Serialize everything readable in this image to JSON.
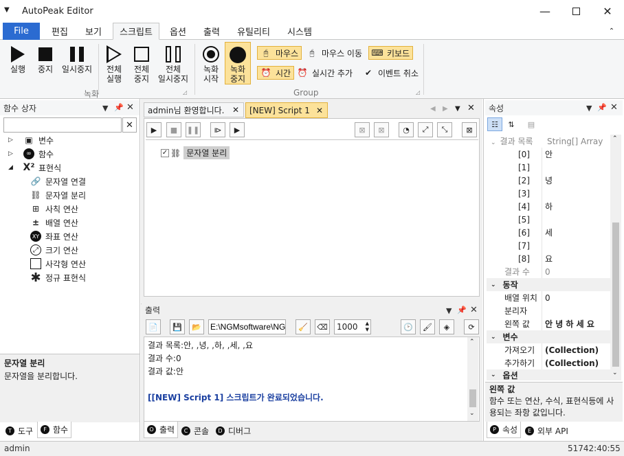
{
  "window": {
    "title": "AutoPeak Editor"
  },
  "menu": {
    "tabs": [
      "File",
      "편집",
      "보기",
      "스크립트",
      "옵션",
      "출력",
      "유틸리티",
      "시스템"
    ],
    "active": "스크립트"
  },
  "ribbon": {
    "record_group": {
      "label": "녹화",
      "buttons": [
        {
          "line1": "실행",
          "line2": ""
        },
        {
          "line1": "중지",
          "line2": ""
        },
        {
          "line1": "일시중지",
          "line2": ""
        },
        {
          "line1": "전체",
          "line2": "실행"
        },
        {
          "line1": "전체",
          "line2": "중지"
        },
        {
          "line1": "전체",
          "line2": "일시중지"
        }
      ]
    },
    "group": {
      "label": "Group",
      "rec_start": {
        "line1": "녹화",
        "line2": "시작"
      },
      "rec_stop": {
        "line1": "녹화",
        "line2": "중지"
      },
      "mouse": "마우스",
      "mouse_move": "마우스 이동",
      "keyboard": "키보드",
      "time": "시간",
      "realtime_add": "실시간 추가",
      "event_cancel": "이벤트 취소"
    }
  },
  "left_panel": {
    "title": "함수 상자",
    "search_placeholder": "",
    "tree": [
      {
        "label": "변수",
        "icon": "variable-icon",
        "expander": "▷",
        "level": 0
      },
      {
        "label": "함수",
        "icon": "function-icon",
        "expander": "▷",
        "level": 0
      },
      {
        "label": "표현식",
        "icon": "expression-icon",
        "expander": "◢",
        "level": 0
      },
      {
        "label": "문자열 연결",
        "icon": "link-icon",
        "level": 1
      },
      {
        "label": "문자열 분리",
        "icon": "unlink-icon",
        "level": 1
      },
      {
        "label": "사칙 연산",
        "icon": "calculator-icon",
        "level": 1
      },
      {
        "label": "배열 연산",
        "icon": "plus-minus-icon",
        "level": 1
      },
      {
        "label": "좌표 연산",
        "icon": "xy-icon",
        "level": 1
      },
      {
        "label": "크기 연산",
        "icon": "resize-icon",
        "level": 1
      },
      {
        "label": "사각형 연산",
        "icon": "rectangle-icon",
        "level": 1
      },
      {
        "label": "정규 표현식",
        "icon": "asterisk-icon",
        "level": 1
      }
    ],
    "desc_title": "문자열 분리",
    "desc_text": "문자열을 분리합니다.",
    "bottom_tabs": [
      {
        "badge": "T",
        "label": "도구"
      },
      {
        "badge": "F",
        "label": "함수"
      }
    ]
  },
  "editor": {
    "tabs": [
      {
        "label": "admin님 환영합니다."
      },
      {
        "label": "[NEW] Script 1"
      }
    ],
    "node_label": "문자열 분리"
  },
  "output": {
    "title": "출력",
    "path": "E:\\NGMsoftware\\NG",
    "count": "1000",
    "lines": [
      "결과 목록:안, ,녕, ,하, ,세, ,요",
      "결과 수:0",
      "결과 값:안",
      "",
      "[[NEW] Script 1] 스크립트가 완료되었습니다."
    ],
    "bottom_tabs": [
      {
        "badge": "O",
        "label": "출력"
      },
      {
        "badge": "C",
        "label": "콘솔"
      },
      {
        "badge": "D",
        "label": "디버그"
      }
    ]
  },
  "properties": {
    "title": "속성",
    "result_list": {
      "key": "결과 목록",
      "type": "String[] Array"
    },
    "items": [
      {
        "k": "[0]",
        "v": "안"
      },
      {
        "k": "[1]",
        "v": ""
      },
      {
        "k": "[2]",
        "v": "녕"
      },
      {
        "k": "[3]",
        "v": ""
      },
      {
        "k": "[4]",
        "v": "하"
      },
      {
        "k": "[5]",
        "v": ""
      },
      {
        "k": "[6]",
        "v": "세"
      },
      {
        "k": "[7]",
        "v": ""
      },
      {
        "k": "[8]",
        "v": "요"
      }
    ],
    "result_count": {
      "k": "결과 수",
      "v": "0"
    },
    "cat_action": "동작",
    "action_rows": [
      {
        "k": "배열 위치",
        "v": "0"
      },
      {
        "k": "분리자",
        "v": ""
      },
      {
        "k": "왼쪽 값",
        "v": "안 녕 하 세 요"
      }
    ],
    "cat_var": "변수",
    "var_rows": [
      {
        "k": "가져오기",
        "v": "(Collection)"
      },
      {
        "k": "추가하기",
        "v": "(Collection)"
      }
    ],
    "cat_option": "옵션",
    "desc_title": "왼쪽 값",
    "desc_text": "함수 또는 연산, 수식, 표현식등에 사용되는 좌항 값입니다.",
    "bottom_tabs": [
      {
        "badge": "P",
        "label": "속성"
      },
      {
        "badge": "E",
        "label": "외부 API"
      }
    ]
  },
  "status": {
    "user": "admin",
    "time": "51742:40:55"
  }
}
